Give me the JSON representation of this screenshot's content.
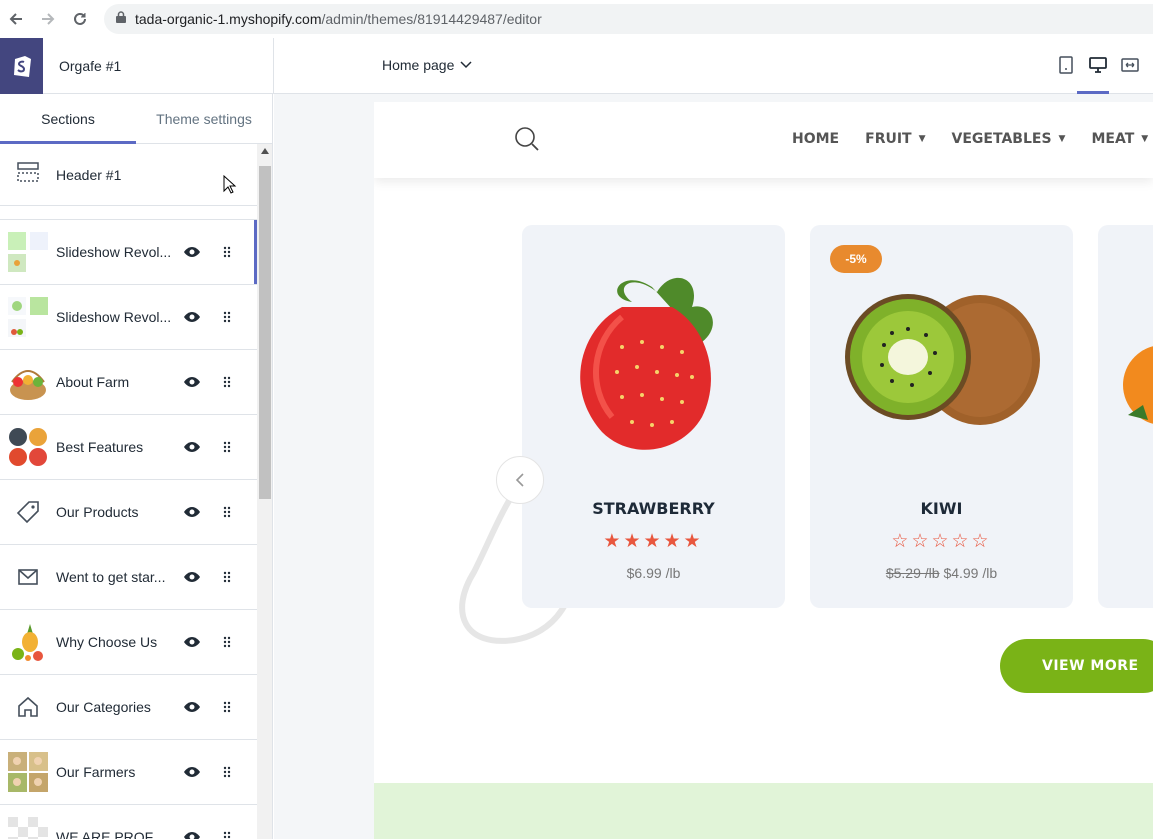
{
  "browser": {
    "url_host": "tada-organic-1.myshopify.com",
    "url_path": "/admin/themes/81914429487/editor"
  },
  "topbar": {
    "theme_name": "Orgafe #1",
    "page_selector": "Home page"
  },
  "sidebar": {
    "tabs": [
      {
        "label": "Sections"
      },
      {
        "label": "Theme settings"
      }
    ],
    "header_item": {
      "label": "Header #1"
    },
    "items": [
      {
        "label": "Slideshow Revol...",
        "thumb": "slideshow-thumb"
      },
      {
        "label": "Slideshow Revol...",
        "thumb": "slideshow-thumb"
      },
      {
        "label": "About Farm",
        "thumb": "fruit-basket-thumb"
      },
      {
        "label": "Best Features",
        "thumb": "features-thumb"
      },
      {
        "label": "Our Products",
        "thumb": "tag-icon"
      },
      {
        "label": "Went to get star...",
        "thumb": "envelope-icon"
      },
      {
        "label": "Why Choose Us",
        "thumb": "fruit-splash-thumb"
      },
      {
        "label": "Our Categories",
        "thumb": "home-icon"
      },
      {
        "label": "Our Farmers",
        "thumb": "farmers-thumb"
      },
      {
        "label": "WE ARE PROFES...",
        "thumb": "transparent-thumb"
      }
    ]
  },
  "preview": {
    "menu": [
      {
        "label": "HOME",
        "dropdown": false
      },
      {
        "label": "FRUIT",
        "dropdown": true
      },
      {
        "label": "VEGETABLES",
        "dropdown": true
      },
      {
        "label": "MEAT",
        "dropdown": true
      }
    ],
    "products": [
      {
        "name": "STRAWBERRY",
        "rating": 5,
        "price": "$6.99 /lb",
        "old_price": "",
        "badge": ""
      },
      {
        "name": "KIWI",
        "rating": 0,
        "price": "$4.99 /lb",
        "old_price": "$5.29 /lb",
        "badge": "-5%"
      }
    ],
    "view_more_label": "VIEW MORE",
    "colors": {
      "accent_green": "#7ab317",
      "badge_orange": "#e88a2e",
      "star_color": "#e8563e",
      "admin_purple": "#5c6ac4"
    }
  }
}
